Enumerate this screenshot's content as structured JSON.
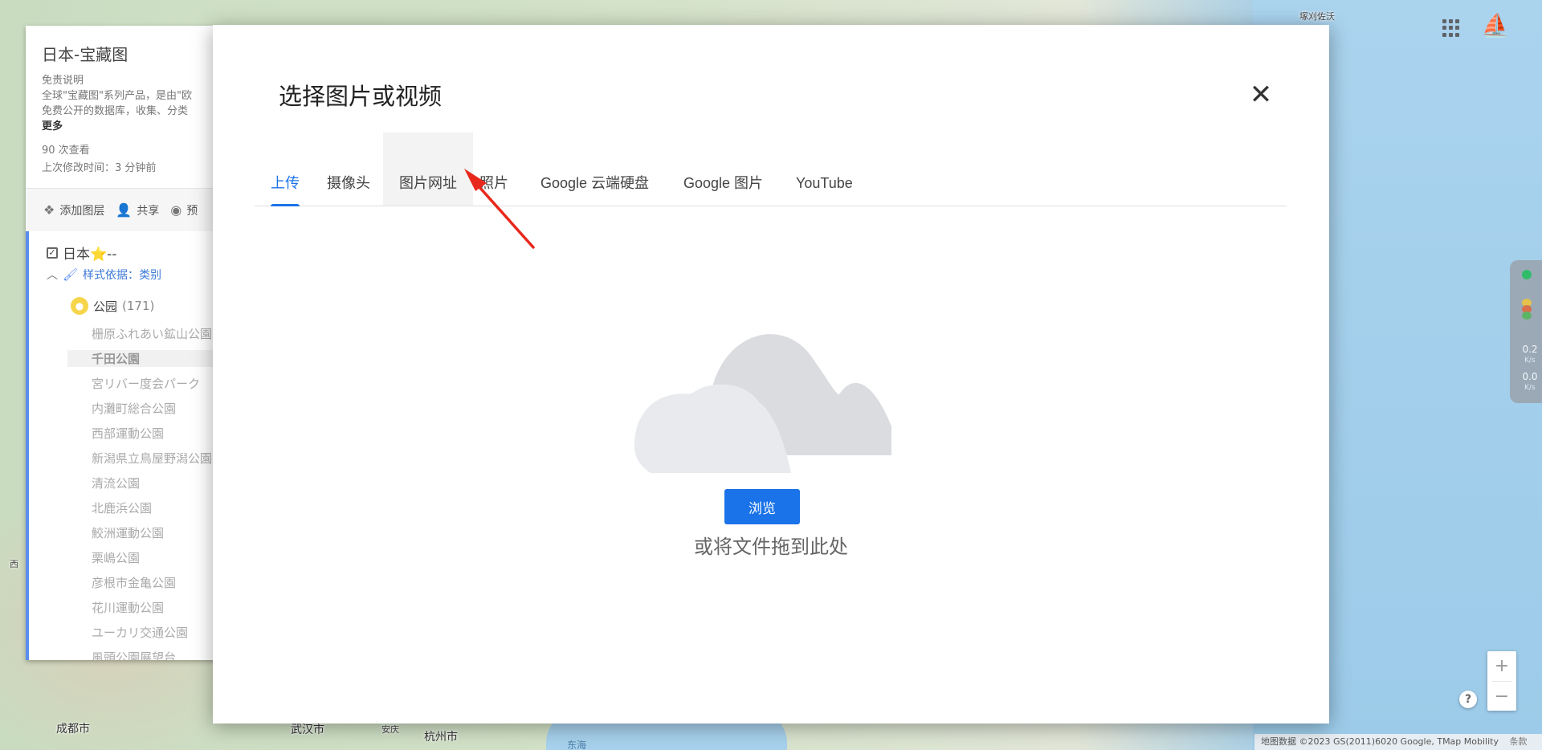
{
  "map": {
    "labels": {
      "nw_town": "塚刈佐沃",
      "chengdu": "成都市",
      "wuhan": "武汉市",
      "anqing": "安庆",
      "hangzhou": "杭州市",
      "east_sea": "东海",
      "west": "西"
    },
    "attribution": "地图数据 ©2023 GS(2011)6020 Google, TMap Mobility",
    "terms": "条款",
    "zoom_in": "+",
    "zoom_out": "−",
    "help": "?"
  },
  "top_right": {
    "apps_icon": "apps-grid-icon",
    "avatar_glyph": "⛵"
  },
  "net_widget": {
    "upload": "0.2",
    "upload_unit": "K/s",
    "download": "0.0",
    "download_unit": "K/s",
    "colors": [
      "#1db954",
      "#f0c030",
      "#e06030",
      "#50b050"
    ]
  },
  "left_panel": {
    "title": "日本-宝藏图",
    "desc_heading": "免责说明",
    "desc_line1": "全球\"宝藏图\"系列产品，是由\"欧",
    "desc_line2": "免费公开的数据库，收集、分类",
    "more": "更多",
    "views": "90 次查看",
    "modified": "上次修改时间：3 分钟前",
    "toolbar": {
      "add_layer": "添加图层",
      "share": "共享",
      "preview": "预"
    },
    "layer": {
      "name": "日本⭐--",
      "style_by": "样式依据：类别",
      "category": "公园",
      "count": "(171)"
    },
    "places": [
      "栅原ふれあい鉱山公園",
      "千田公園",
      "宮リバー度会パーク",
      "内灘町総合公園",
      "西部運動公園",
      "新潟県立鳥屋野潟公園",
      "清流公園",
      "北鹿浜公園",
      "鮫洲運動公園",
      "栗嶋公園",
      "彦根市金亀公園",
      "花川運動公園",
      "ユーカリ交通公園",
      "風頭公園展望台"
    ]
  },
  "dialog": {
    "title": "选择图片或视频",
    "close": "✕",
    "tabs": [
      "上传",
      "摄像头",
      "图片网址",
      "照片",
      "Google 云端硬盘",
      "Google 图片",
      "YouTube"
    ],
    "active_tab": "上传",
    "hovered_tab": "图片网址",
    "browse": "浏览",
    "drop_hint": "或将文件拖到此处",
    "accent": "#1a73e8"
  }
}
